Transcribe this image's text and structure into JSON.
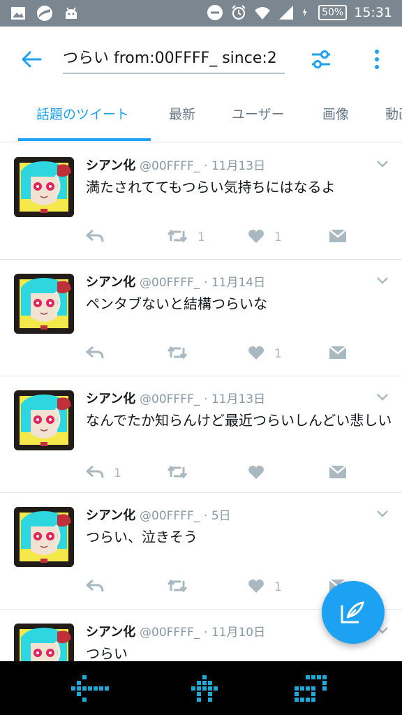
{
  "status_bar": {
    "time": "15:31",
    "battery": "50%",
    "icons": [
      "gallery-icon",
      "app-icon",
      "android-icon",
      "do-not-disturb-icon",
      "alarm-icon",
      "wifi-icon",
      "signal-icon",
      "charging-icon"
    ]
  },
  "app_bar": {
    "search_query": "つらい from:00FFFF_ since:2",
    "back_icon": "back-arrow-icon",
    "filter_icon": "filter-sliders-icon",
    "more_icon": "more-vertical-icon"
  },
  "tabs": [
    {
      "label": "話題のツイート",
      "active": true
    },
    {
      "label": "最新",
      "active": false
    },
    {
      "label": "ユーザー",
      "active": false
    },
    {
      "label": "画像",
      "active": false
    },
    {
      "label": "動画",
      "active": false
    }
  ],
  "tweets": [
    {
      "name": "シアン化",
      "handle": "@00FFFF_",
      "date": "11月13日",
      "text": "満たされててもつらい気持ちにはなるよ",
      "replies": "",
      "retweets": "1",
      "likes": "1"
    },
    {
      "name": "シアン化",
      "handle": "@00FFFF_",
      "date": "11月14日",
      "text": "ペンタブないと結構つらいな",
      "replies": "",
      "retweets": "",
      "likes": "1"
    },
    {
      "name": "シアン化",
      "handle": "@00FFFF_",
      "date": "11月13日",
      "text": "なんでたか知らんけど最近つらいしんどい悲しい",
      "replies": "1",
      "retweets": "",
      "likes": ""
    },
    {
      "name": "シアン化",
      "handle": "@00FFFF_",
      "date": "5日",
      "text": "つらい、泣きそう",
      "replies": "",
      "retweets": "",
      "likes": "1"
    },
    {
      "name": "シアン化",
      "handle": "@00FFFF_",
      "date": "11月10日",
      "text": "つらい",
      "replies": "",
      "retweets": "",
      "likes": ""
    }
  ],
  "colors": {
    "accent": "#1da1f2",
    "status_bar": "#7a8791",
    "text": "#14171a",
    "secondary_text": "#8899a6",
    "action_gray": "#aab8c2",
    "nav_icons": "#1fa9d6"
  },
  "compose_icon": "compose-tweet-icon",
  "nav_bar": [
    "nav-back-icon",
    "nav-home-icon",
    "nav-recents-icon"
  ]
}
